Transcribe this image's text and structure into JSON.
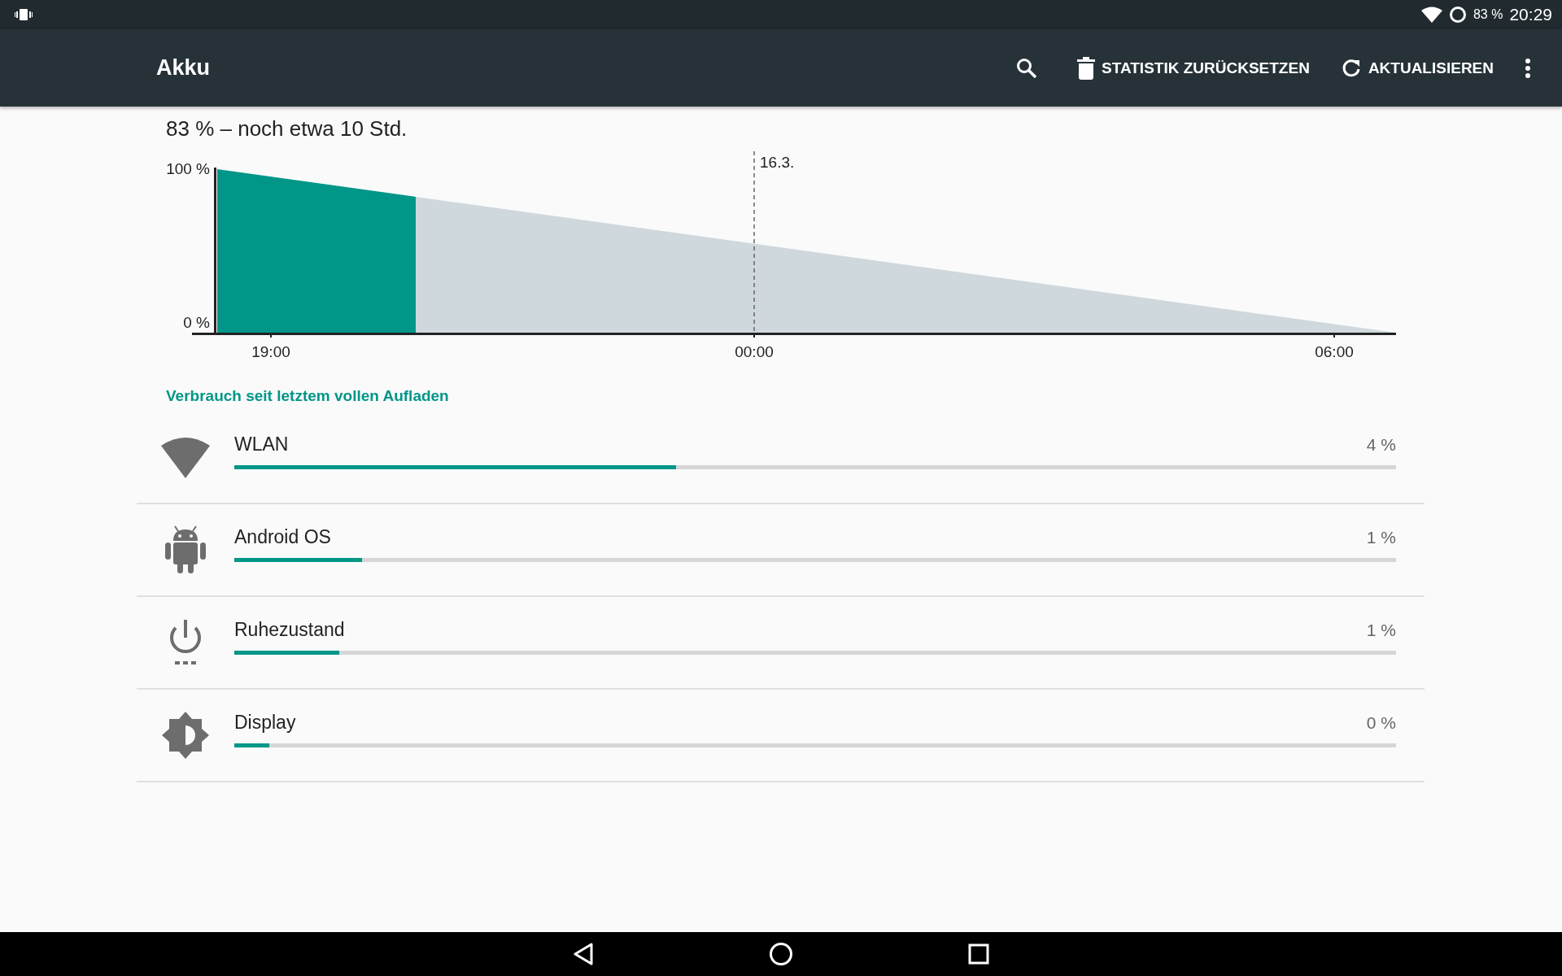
{
  "status_bar": {
    "battery": "83 %",
    "time": "20:29"
  },
  "app_bar": {
    "title": "Akku",
    "actions": [
      {
        "label": "STATISTIK ZURÜCKSETZEN"
      },
      {
        "label": "AKTUALISIEREN"
      }
    ]
  },
  "summary": "83 % – noch etwa 10 Std.",
  "battery_chart": {
    "y_axis_labels": [
      "100 %",
      "0 %"
    ],
    "x_axis_labels": [
      "19:00",
      "00:00",
      "06:00"
    ],
    "date_marker": "16.3."
  },
  "section_header": "Verbrauch seit letztem vollen Aufladen",
  "usage": [
    {
      "kind": "wifi",
      "name": "WLAN",
      "level": 0.38,
      "percent": "4 %"
    },
    {
      "kind": "android",
      "name": "Android OS",
      "level": 0.11,
      "percent": "1 %"
    },
    {
      "kind": "power",
      "name": "Ruhezustand",
      "level": 0.09,
      "percent": "1 %"
    },
    {
      "kind": "display",
      "name": "Display",
      "level": 0.03,
      "percent": "0 %"
    }
  ]
}
